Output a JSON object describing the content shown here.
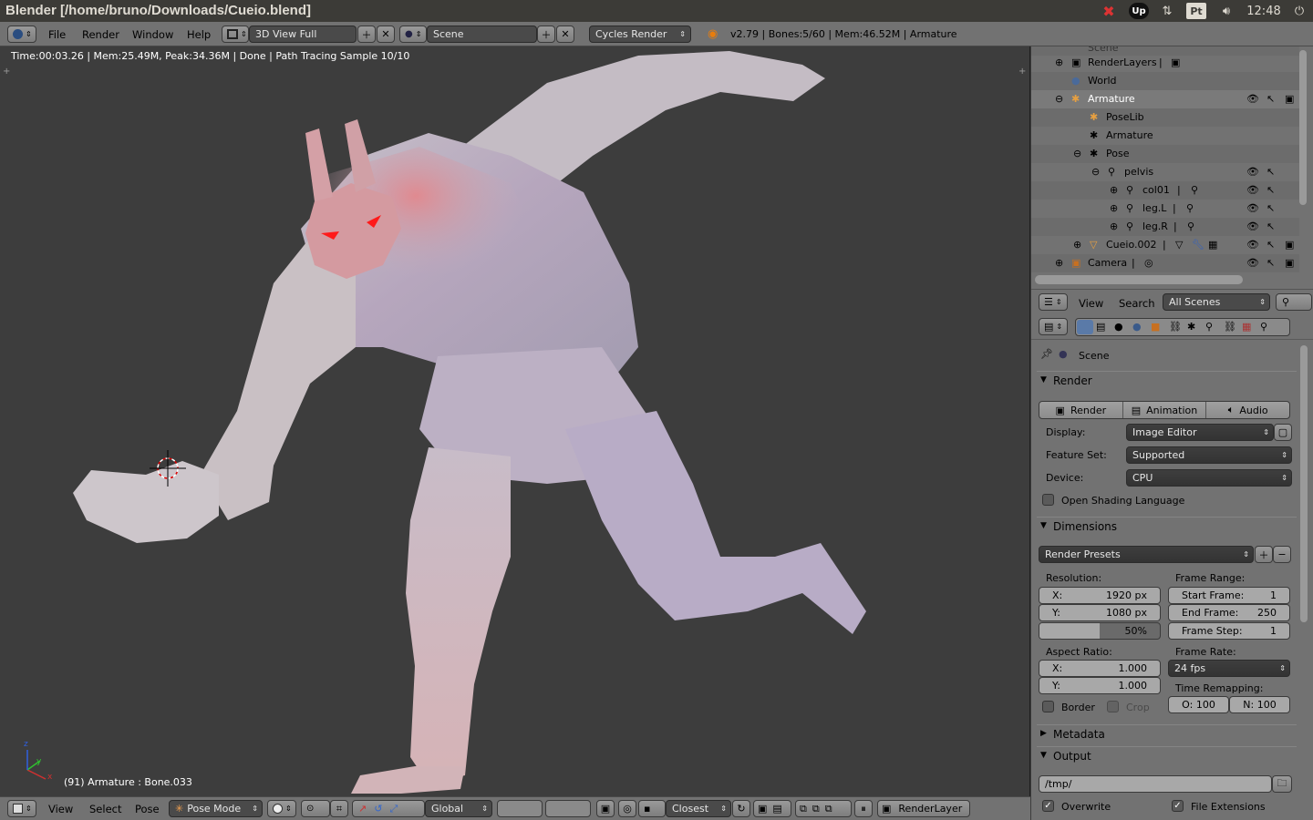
{
  "os": {
    "window_title": "Blender [/home/bruno/Downloads/Cueio.blend]",
    "lang": "Pt",
    "clock": "12:48"
  },
  "info_header": {
    "menus": [
      "File",
      "Render",
      "Window",
      "Help"
    ],
    "screen_layout": "3D View Full",
    "scene": "Scene",
    "render_engine": "Cycles Render",
    "stats": "v2.79 | Bones:5/60  | Mem:46.52M | Armature"
  },
  "viewport": {
    "render_status": "Time:00:03.26 | Mem:25.49M, Peak:34.36M | Done | Path Tracing Sample 10/10",
    "object_info": "(91) Armature : Bone.033",
    "axis_x": "x",
    "axis_y": "y",
    "axis_z": "z"
  },
  "viewport_footer": {
    "menus": [
      "View",
      "Select",
      "Pose"
    ],
    "mode": "Pose Mode",
    "orientation": "Global",
    "snap": "Closest",
    "render_layer": "RenderLayer"
  },
  "outliner": {
    "top_partial": "Scene",
    "rows": [
      {
        "label": "RenderLayers",
        "indent": 1
      },
      {
        "label": "World",
        "indent": 1
      },
      {
        "label": "Armature",
        "indent": 1
      },
      {
        "label": "PoseLib",
        "indent": 2
      },
      {
        "label": "Armature",
        "indent": 2
      },
      {
        "label": "Pose",
        "indent": 2
      },
      {
        "label": "pelvis",
        "indent": 3
      },
      {
        "label": "col01",
        "indent": 4
      },
      {
        "label": "leg.L",
        "indent": 4
      },
      {
        "label": "leg.R",
        "indent": 4
      },
      {
        "label": "Cueio.002",
        "indent": 1
      },
      {
        "label": "Camera",
        "indent": 1
      }
    ],
    "header": {
      "view": "View",
      "search": "Search",
      "filter": "All Scenes"
    }
  },
  "properties": {
    "context": "Scene",
    "render_panel": {
      "title": "Render",
      "buttons": [
        "Render",
        "Animation",
        "Audio"
      ],
      "display_label": "Display:",
      "display_value": "Image Editor",
      "feature_set_label": "Feature Set:",
      "feature_set_value": "Supported",
      "device_label": "Device:",
      "device_value": "CPU",
      "osl_label": "Open Shading Language"
    },
    "dimensions_panel": {
      "title": "Dimensions",
      "presets": "Render Presets",
      "resolution_label": "Resolution:",
      "res_x_label": "X:",
      "res_x": "1920 px",
      "res_y_label": "Y:",
      "res_y": "1080 px",
      "res_pct": "50%",
      "res_pct_value": 0.5,
      "frame_range_label": "Frame Range:",
      "start_label": "Start Frame:",
      "start": "1",
      "end_label": "End Frame:",
      "end": "250",
      "step_label": "Frame Step:",
      "step": "1",
      "aspect_label": "Aspect Ratio:",
      "aspect_x_label": "X:",
      "aspect_x": "1.000",
      "aspect_y_label": "Y:",
      "aspect_y": "1.000",
      "frame_rate_label": "Frame Rate:",
      "frame_rate": "24 fps",
      "time_remap_label": "Time Remapping:",
      "remap_old": "O: 100",
      "remap_new": "N: 100",
      "border_label": "Border",
      "crop_label": "Crop"
    },
    "metadata_panel": {
      "title": "Metadata"
    },
    "output_panel": {
      "title": "Output",
      "path": "/tmp/",
      "overwrite_label": "Overwrite",
      "file_ext_label": "File Extensions"
    }
  }
}
